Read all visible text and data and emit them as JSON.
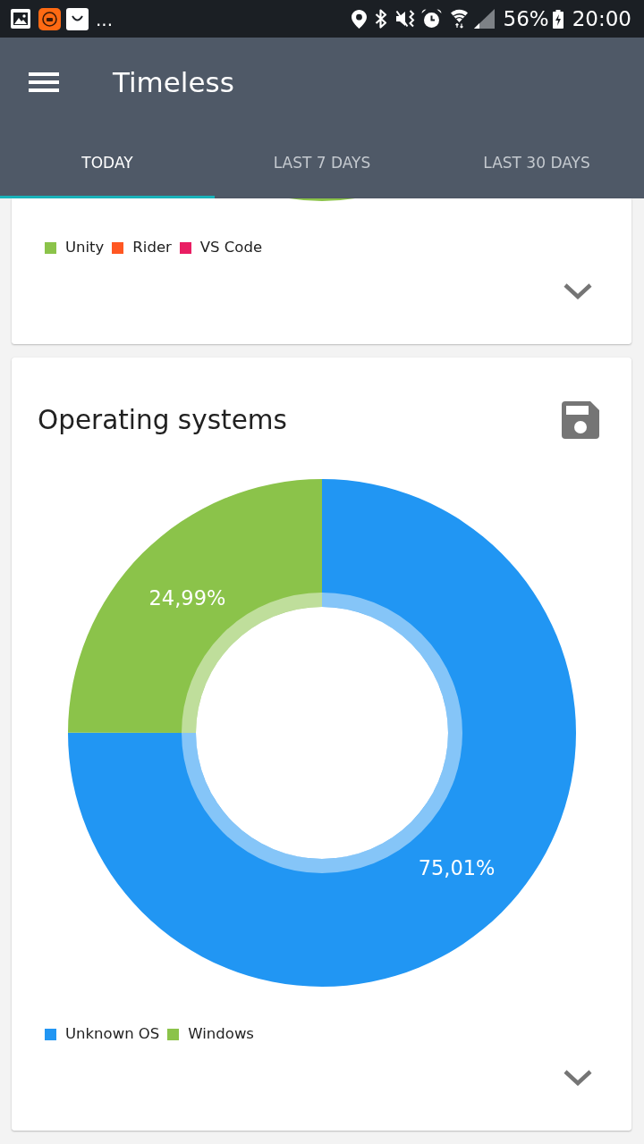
{
  "status_bar": {
    "overflow": "...",
    "battery": "56%",
    "time": "20:00"
  },
  "app_bar": {
    "title": "Timeless"
  },
  "tabs": [
    {
      "label": "TODAY",
      "selected": true
    },
    {
      "label": "LAST 7 DAYS",
      "selected": false
    },
    {
      "label": "LAST 30 DAYS",
      "selected": false
    }
  ],
  "cards": [
    {
      "legend": [
        {
          "label": "Unity",
          "color": "#8bc34a"
        },
        {
          "label": "Rider",
          "color": "#ff5722"
        },
        {
          "label": "VS Code",
          "color": "#e91e63"
        }
      ],
      "expanded": false
    },
    {
      "title": "Operating systems",
      "chart_data": {
        "type": "donut",
        "categories": [
          "Unknown OS",
          "Windows"
        ],
        "values": [
          75.01,
          24.99
        ],
        "colors": [
          "#2196f3",
          "#8bc34a"
        ],
        "value_labels": [
          "75,01%",
          "24,99%"
        ]
      },
      "expanded": false
    }
  ]
}
